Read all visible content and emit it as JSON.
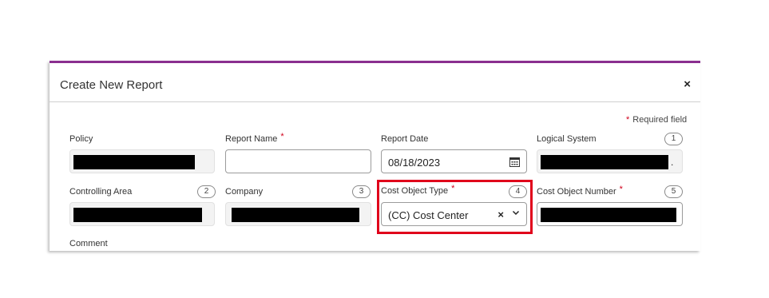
{
  "dialog": {
    "title": "Create New Report",
    "close_glyph": "×",
    "required_note": "Required field",
    "required_star": "*"
  },
  "fields": {
    "policy": {
      "label": "Policy"
    },
    "report_name": {
      "label": "Report Name",
      "value": ""
    },
    "report_date": {
      "label": "Report Date",
      "value": "08/18/2023"
    },
    "logical_system": {
      "label": "Logical System",
      "badge": "1",
      "trailing": "."
    },
    "controlling_area": {
      "label": "Controlling Area",
      "badge": "2"
    },
    "company": {
      "label": "Company",
      "badge": "3"
    },
    "cost_object_type": {
      "label": "Cost Object Type",
      "badge": "4",
      "value": "(CC) Cost Center",
      "clear_glyph": "×"
    },
    "cost_object_number": {
      "label": "Cost Object Number",
      "badge": "5"
    },
    "comment": {
      "label": "Comment"
    }
  },
  "icons": {
    "calendar": "calendar-icon",
    "clear": "close-icon",
    "dropdown": "chevron-down-icon"
  },
  "colors": {
    "accent_bar": "#8a2f8f",
    "required_star": "#d0011b",
    "highlight_box": "#e0001b"
  }
}
